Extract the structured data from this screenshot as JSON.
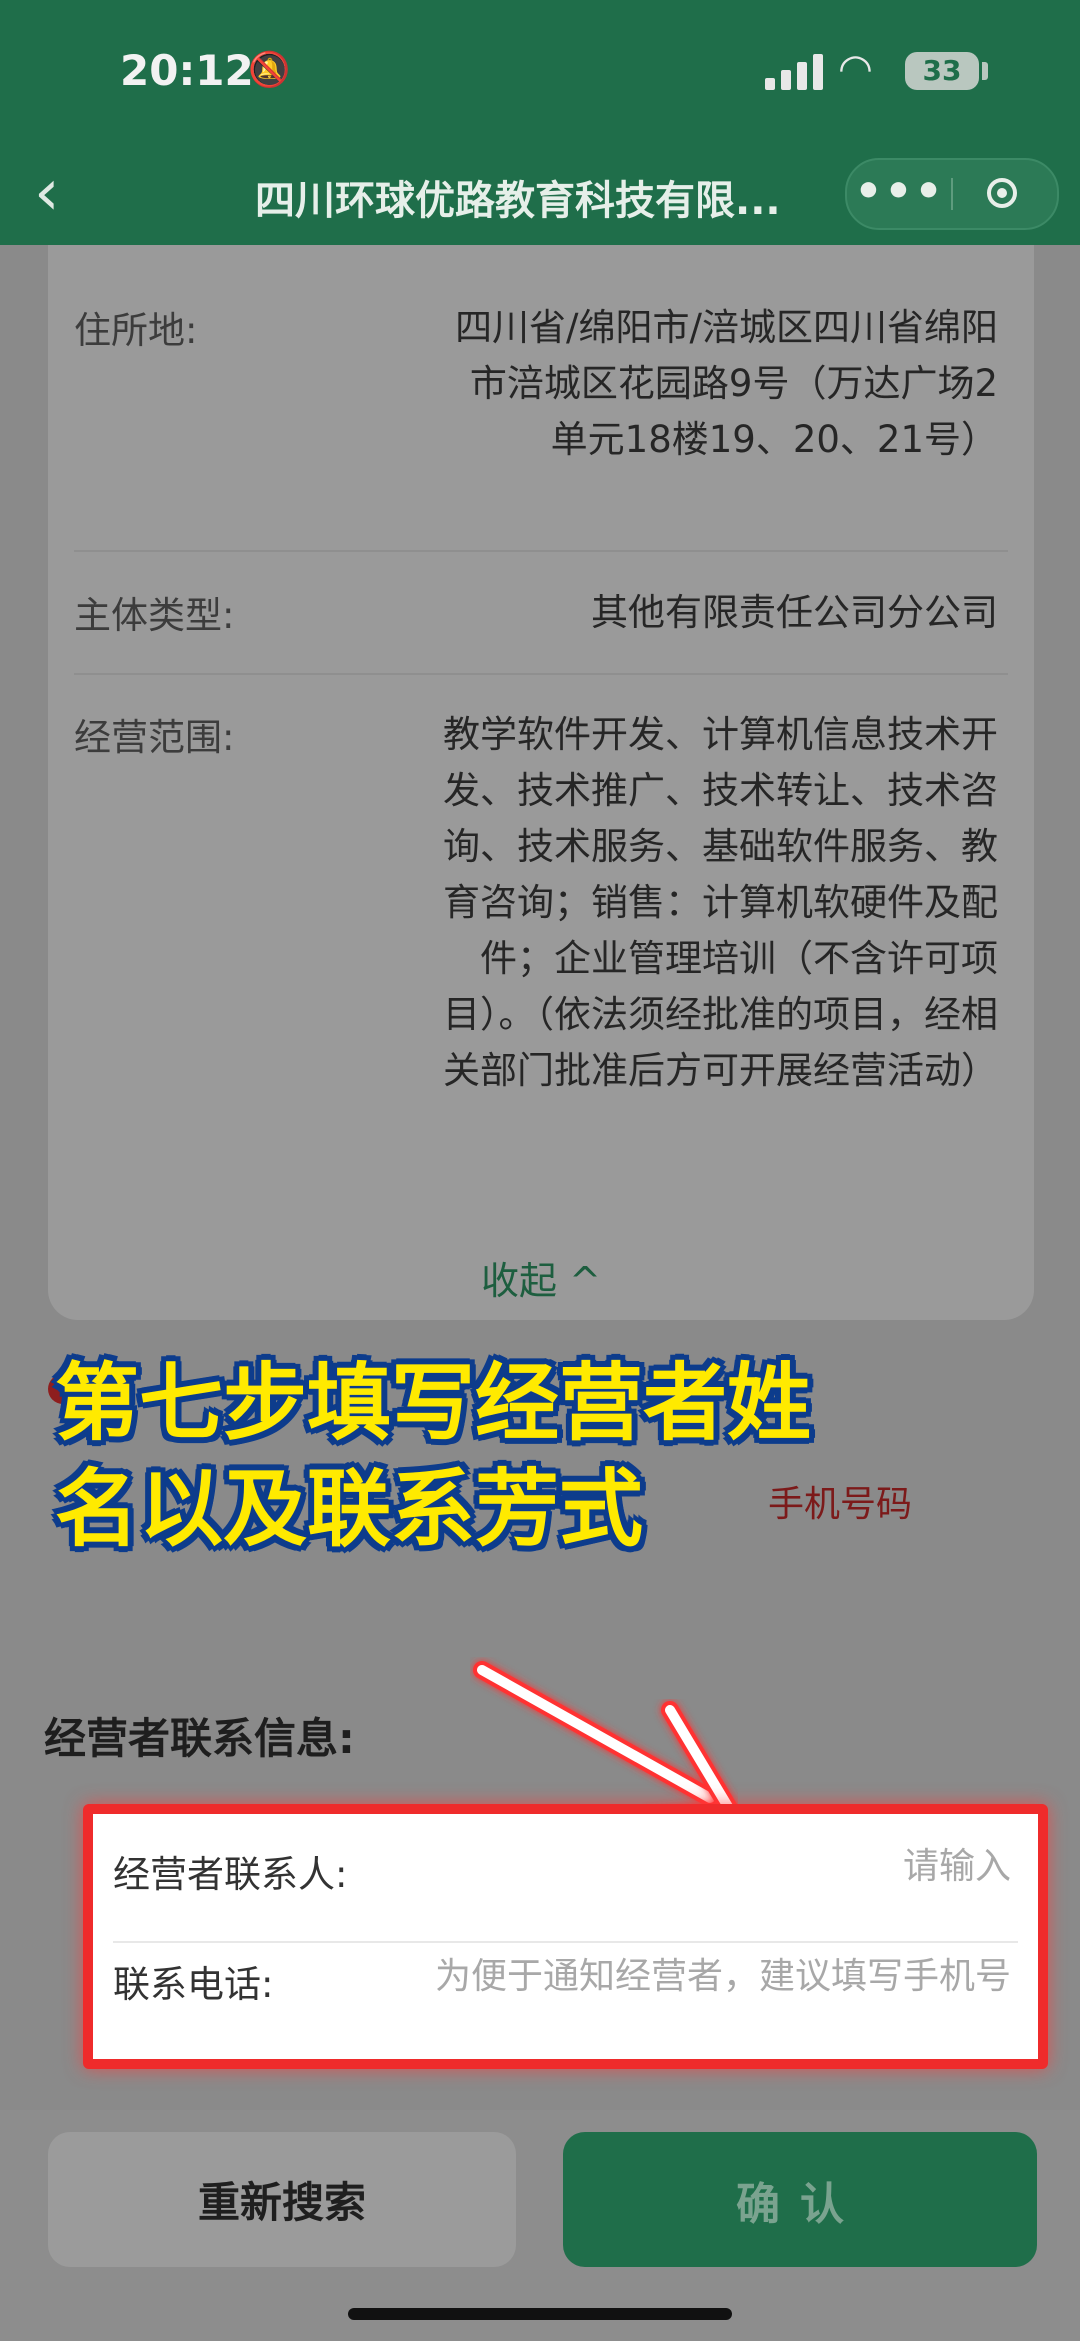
{
  "status_bar": {
    "time": "20:12",
    "battery": "33"
  },
  "nav": {
    "title": "四川环球优路教育科技有限..."
  },
  "company_info": {
    "rows": [
      {
        "label": "住所地:",
        "value": "四川省/绵阳市/涪城区四川省绵阳市涪城区花园路9号（万达广场2单元18楼19、20、21号）"
      },
      {
        "label": "主体类型:",
        "value": "其他有限责任公司分公司"
      },
      {
        "label": "经营范围:",
        "value": "教学软件开发、计算机信息技术开发、技术推广、技术转让、技术咨询、技术服务、基础软件服务、教育咨询；销售：计算机软硬件及配件；企业管理培训（不含许可项目）。（依法须经批准的项目，经相关部门批准后方可开展经营活动）"
      }
    ],
    "collapse_label": "收起 ^"
  },
  "notice": {
    "phone_text": "手机号码"
  },
  "overlay": {
    "line1": "第七步填写经营者姓",
    "line2": "名以及联系芳式"
  },
  "contact": {
    "section_title": "经营者联系信息:",
    "name_label": "经营者联系人:",
    "name_placeholder": "请输入",
    "phone_label": "联系电话:",
    "phone_placeholder": "为便于通知经营者，建议填写手机号"
  },
  "actions": {
    "research_label": "重新搜索",
    "confirm_label": "确认"
  },
  "colors": {
    "header_green": "#1f6e4a",
    "highlight_red": "#ef2b2b",
    "overlay_yellow": "#ffea00"
  }
}
